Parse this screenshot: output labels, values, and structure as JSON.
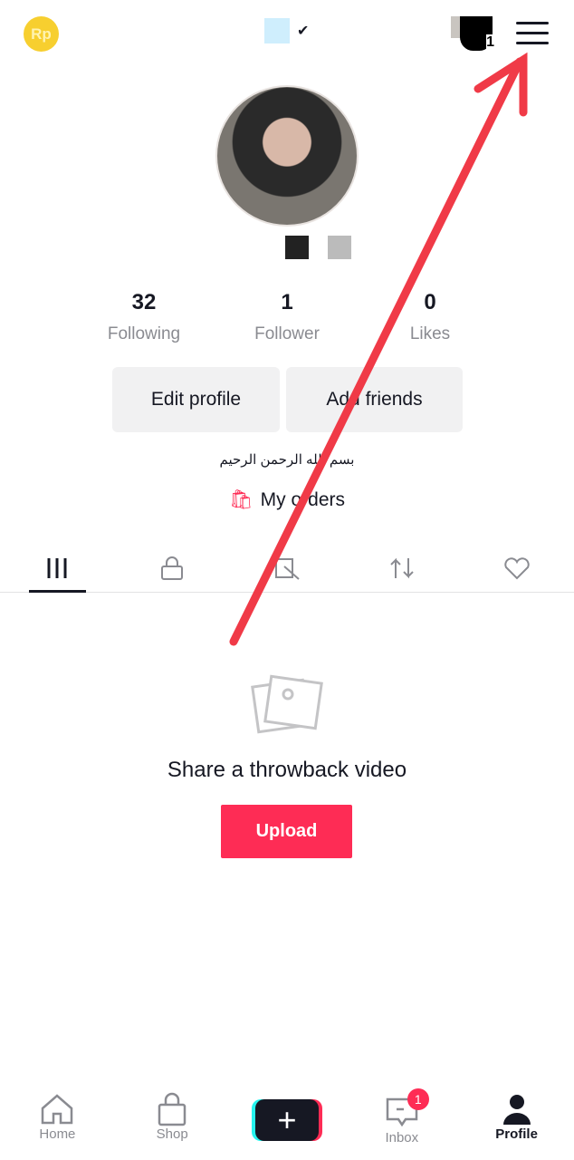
{
  "header": {
    "coin_label": "Rp",
    "friends_count": "1",
    "verified": "✔"
  },
  "stats": [
    {
      "value": "32",
      "label": "Following"
    },
    {
      "value": "1",
      "label": "Follower"
    },
    {
      "value": "0",
      "label": "Likes"
    }
  ],
  "buttons": {
    "edit_profile": "Edit profile",
    "add_friends": "Add friends"
  },
  "bio": "بسم الله الرحمن الرحيم",
  "orders": "My orders",
  "tabs": [
    "videos-grid",
    "private-lock",
    "hidden-posts",
    "reposts",
    "liked-hidden"
  ],
  "empty": {
    "title": "Share a throwback video",
    "upload": "Upload"
  },
  "nav": {
    "home": "Home",
    "shop": "Shop",
    "inbox": "Inbox",
    "inbox_badge": "1",
    "profile": "Profile"
  },
  "colors": {
    "accent": "#fe2c55",
    "annotation_arrow": "#f03a47"
  }
}
